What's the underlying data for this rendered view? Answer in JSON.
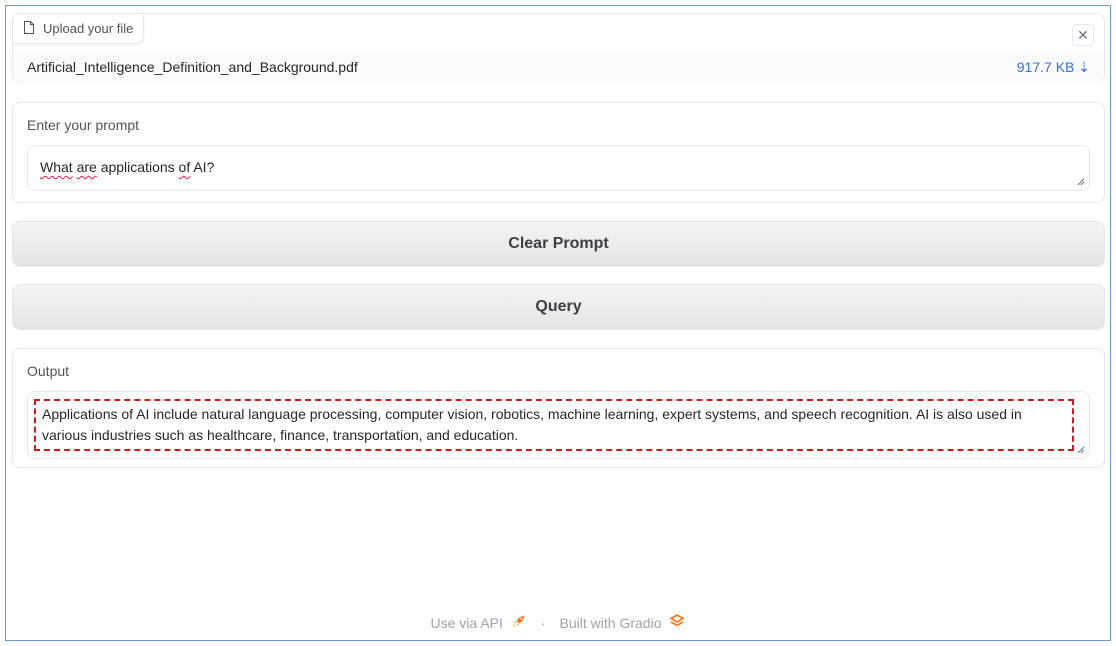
{
  "upload": {
    "label": "Upload your file",
    "file_name": "Artificial_Intelligence_Definition_and_Background.pdf",
    "file_size": "917.7 KB",
    "download_glyph": "⇣",
    "close_glyph": "✕"
  },
  "prompt": {
    "label": "Enter your prompt",
    "value_part1": "What",
    "value_part2": " ",
    "value_part3": "are",
    "value_part4": " applications ",
    "value_part5": "of",
    "value_part6": " AI?"
  },
  "buttons": {
    "clear": "Clear Prompt",
    "query": "Query"
  },
  "output": {
    "label": "Output",
    "text": "Applications of AI include natural language processing, computer vision, robotics, machine learning, expert systems, and speech recognition. AI is also used in various industries such as healthcare, finance, transportation, and education."
  },
  "footer": {
    "api": "Use via API",
    "separator": "·",
    "built": "Built with Gradio"
  },
  "colors": {
    "accent_link": "#3b6fd4",
    "highlight_border": "#c81e1e",
    "frame_border": "#6b9bc8"
  },
  "icons": {
    "file": "file-icon",
    "rocket": "rocket-icon",
    "gradio_logo": "gradio-logo-icon"
  }
}
